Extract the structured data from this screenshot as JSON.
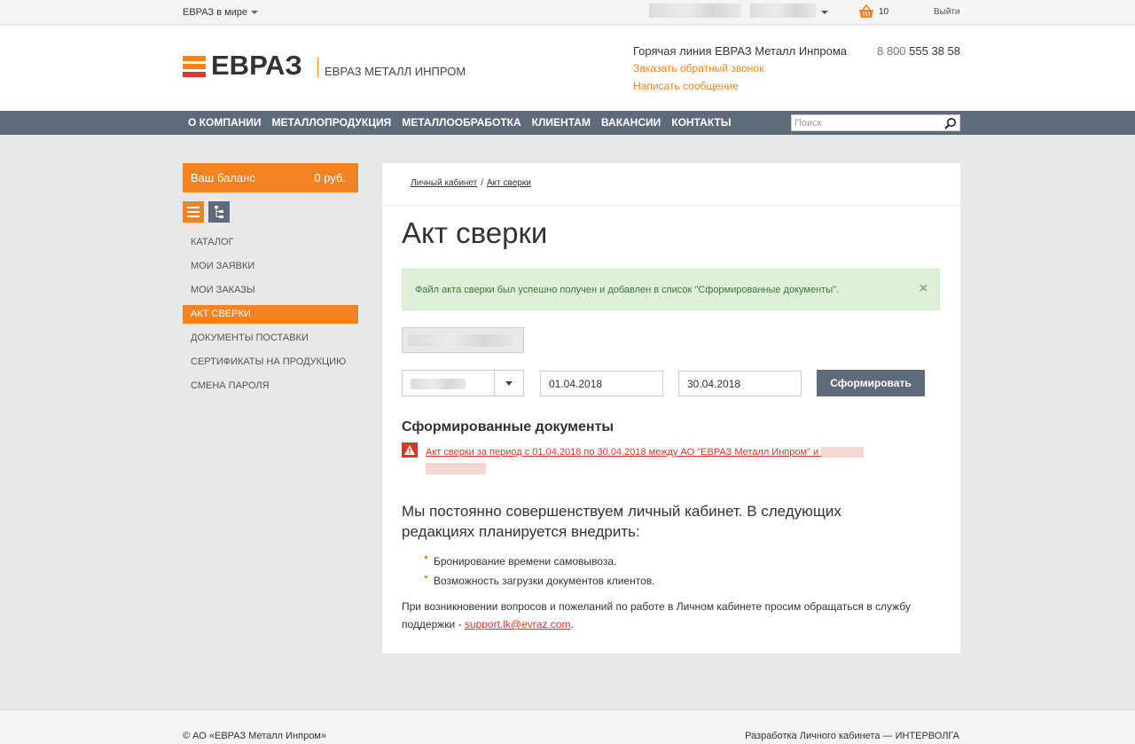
{
  "topbar": {
    "region_label": "ЕВРАЗ в мире",
    "cart_count": "10",
    "logout_label": "Выйти"
  },
  "header": {
    "logo_text": "ЕВРАЗ",
    "logo_sub": "ЕВРАЗ МЕТАЛЛ ИНПРОМ",
    "hotline_label": "Горячая линия ЕВРАЗ Металл Инпрома",
    "phone_prefix": "8 800",
    "phone_number": "555 38 58",
    "callback_label": "Заказать обратный звонок",
    "message_label": "Написать сообщение",
    "logo_colors": [
      "#f58220",
      "#f58220",
      "#d9372b"
    ]
  },
  "nav": {
    "items": [
      {
        "label": "О КОМПАНИИ"
      },
      {
        "label": "МЕТАЛЛОПРОДУКЦИЯ"
      },
      {
        "label": "МЕТАЛЛООБРАБОТКА"
      },
      {
        "label": "КЛИЕНТАМ"
      },
      {
        "label": "ВАКАНСИИ"
      },
      {
        "label": "КОНТАКТЫ"
      }
    ],
    "search_placeholder": "Поиск"
  },
  "sidebar": {
    "balance_label": "Ваш баланс",
    "balance_value": "0 руб.",
    "menu": [
      {
        "label": "КАТАЛОГ"
      },
      {
        "label": "МОИ ЗАЯВКИ"
      },
      {
        "label": "МОИ ЗАКАЗЫ"
      },
      {
        "label": "АКТ СВЕРКИ",
        "active": true
      },
      {
        "label": "ДОКУМЕНТЫ ПОСТАВКИ"
      },
      {
        "label": "СЕРТИФИКАТЫ НА ПРОДУКЦИЮ"
      },
      {
        "label": "СМЕНА ПАРОЛЯ"
      }
    ]
  },
  "main": {
    "breadcrumbs": [
      {
        "label": "Личный кабинет"
      },
      {
        "label": "Акт сверки"
      }
    ],
    "breadcrumb_separator": "/",
    "title": "Акт сверки",
    "alert_text": "Файл акта сверки был успешно получен и добавлен в список \"Сформированные документы\".",
    "alert_close": "×",
    "date_from": "01.04.2018",
    "date_to": "30.04.2018",
    "generate_label": "Сформировать",
    "docs_heading": "Сформированные документы",
    "doc_link_text": "Акт сверки за период с 01.04.2018 по 30.04.2018 между АО \"ЕВРАЗ Металл Инпром\" и",
    "improve_text": "Мы постоянно совершенствуем личный кабинет. В следующих редакциях планируется внедрить:",
    "features": [
      "Бронирование времени самовывоза.",
      "Возможность загрузки документов клиентов."
    ],
    "support_text": "При возникновении вопросов и пожеланий по работе в Личном кабинете просим обращаться в службу поддержки - ",
    "support_email": "support.lk@evraz.com",
    "support_tail": "."
  },
  "footer": {
    "copyright": "© АО «ЕВРАЗ Металл Инпром»",
    "developer": "Разработка Личного кабинета — ИНТЕРВОЛГА"
  },
  "colors": {
    "accent": "#f58220",
    "nav_bg": "#5d6b7a",
    "link_red": "#d9372b",
    "alert_bg": "#def0d8"
  }
}
